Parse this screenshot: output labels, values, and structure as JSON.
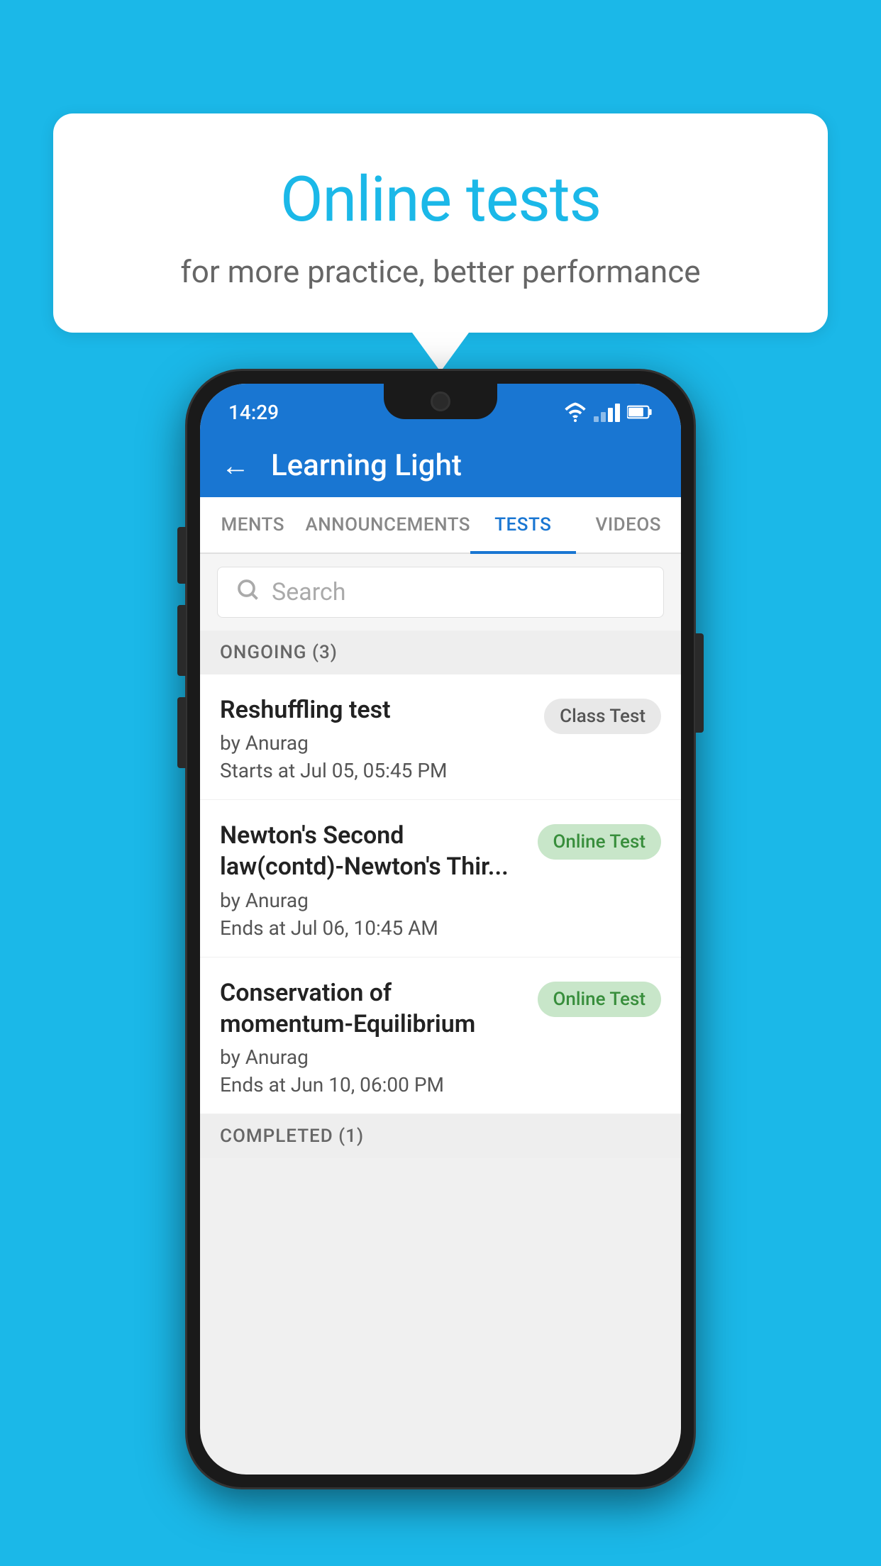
{
  "background_color": "#1bb8e8",
  "speech_bubble": {
    "title": "Online tests",
    "subtitle": "for more practice, better performance"
  },
  "phone": {
    "status_bar": {
      "time": "14:29",
      "wifi": "▼",
      "battery": "▮"
    },
    "header": {
      "back_label": "←",
      "title": "Learning Light"
    },
    "tabs": [
      {
        "label": "MENTS",
        "active": false
      },
      {
        "label": "ANNOUNCEMENTS",
        "active": false
      },
      {
        "label": "TESTS",
        "active": true
      },
      {
        "label": "VIDEOS",
        "active": false
      }
    ],
    "search": {
      "placeholder": "Search"
    },
    "ongoing_section": {
      "label": "ONGOING (3)",
      "tests": [
        {
          "name": "Reshuffling test",
          "author": "by Anurag",
          "time_label": "Starts at",
          "time": "Jul 05, 05:45 PM",
          "badge": "Class Test",
          "badge_type": "class"
        },
        {
          "name": "Newton's Second law(contd)-Newton's Thir...",
          "author": "by Anurag",
          "time_label": "Ends at",
          "time": "Jul 06, 10:45 AM",
          "badge": "Online Test",
          "badge_type": "online"
        },
        {
          "name": "Conservation of momentum-Equilibrium",
          "author": "by Anurag",
          "time_label": "Ends at",
          "time": "Jun 10, 06:00 PM",
          "badge": "Online Test",
          "badge_type": "online"
        }
      ]
    },
    "completed_section": {
      "label": "COMPLETED (1)"
    }
  }
}
